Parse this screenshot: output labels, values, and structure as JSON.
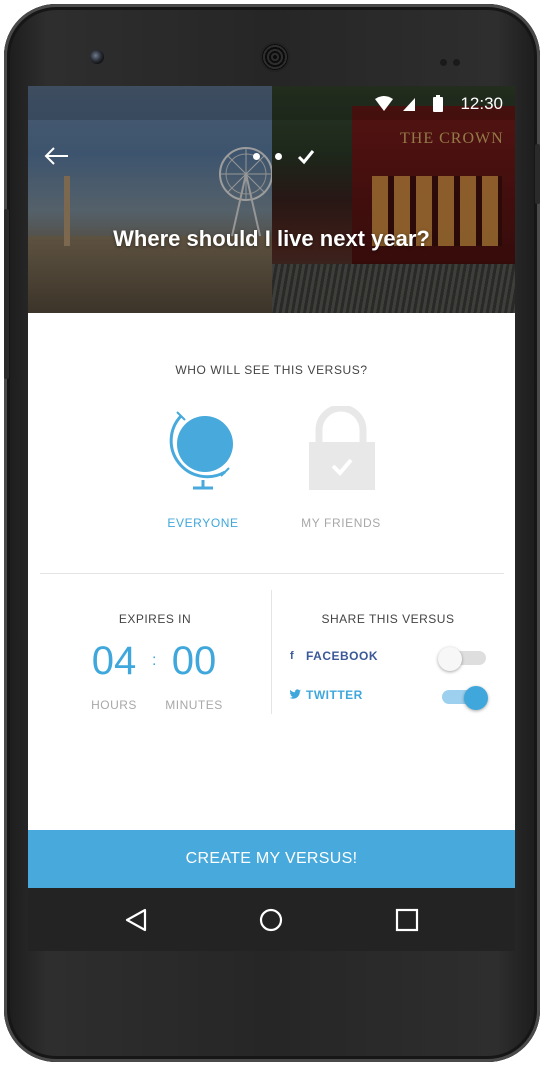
{
  "status_bar": {
    "time": "12:30"
  },
  "hero": {
    "title": "Where should I live next year?",
    "left_image_sign": "",
    "right_image_sign": "THE CROWN",
    "progress_steps": [
      "dot",
      "dot",
      "check"
    ]
  },
  "audience": {
    "title": "WHO WILL SEE THIS VERSUS?",
    "options": [
      {
        "label": "EVERYONE",
        "icon": "globe-icon",
        "selected": true
      },
      {
        "label": "MY FRIENDS",
        "icon": "lock-icon",
        "selected": false
      }
    ]
  },
  "expires": {
    "title": "EXPIRES IN",
    "hours": "04",
    "separator": ":",
    "minutes": "00",
    "hours_label": "HOURS",
    "minutes_label": "MINUTES"
  },
  "share": {
    "title": "SHARE THIS VERSUS",
    "facebook": {
      "icon": "f",
      "label": "FACEBOOK",
      "enabled": false
    },
    "twitter": {
      "icon": "twitter-bird",
      "label": "TWITTER",
      "enabled": true
    }
  },
  "cta": {
    "label": "CREATE MY VERSUS!"
  },
  "colors": {
    "accent": "#47a9dc",
    "facebook": "#3b5998",
    "muted": "#a8a8a8",
    "text": "#444444"
  }
}
